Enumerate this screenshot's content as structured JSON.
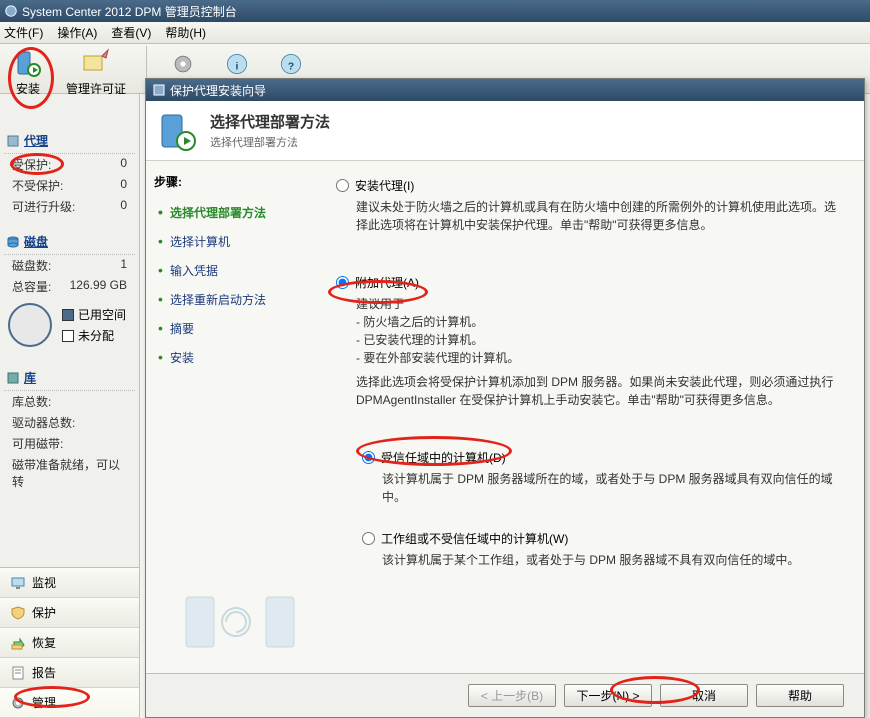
{
  "window_title": "System Center 2012 DPM 管理员控制台",
  "menus": {
    "file": "文件(F)",
    "action": "操作(A)",
    "view": "查看(V)",
    "help": "帮助(H)"
  },
  "tools": {
    "install": "安装",
    "license": "管理许可证",
    "section_label": "代理"
  },
  "sidebar": {
    "agent_header": "代理",
    "protected": "受保护:",
    "protected_val": "0",
    "unprotected": "不受保护:",
    "unprotected_val": "0",
    "upgradeable": "可进行升级:",
    "upgradeable_val": "0",
    "disk_header": "磁盘",
    "disk_count": "磁盘数:",
    "disk_count_val": "1",
    "total_cap": "总容量:",
    "total_cap_val": "126.99 GB",
    "legend_used": "已用空间",
    "legend_unalloc": "未分配",
    "lib_header": "库",
    "lib_total": "库总数:",
    "drive_total": "驱动器总数:",
    "tape_avail": "可用磁带:",
    "tape_ready": "磁带准备就绪，可以转"
  },
  "nav": {
    "monitor": "监视",
    "protect": "保护",
    "recover": "恢复",
    "report": "报告",
    "manage": "管理"
  },
  "wizard": {
    "title": "保护代理安装向导",
    "header": "选择代理部署方法",
    "header_sub": "选择代理部署方法",
    "steps_label": "步骤:",
    "steps": [
      "选择代理部署方法",
      "选择计算机",
      "输入凭据",
      "选择重新启动方法",
      "摘要",
      "安装"
    ],
    "opt_install": "安装代理(I)",
    "opt_install_desc": "建议未处于防火墙之后的计算机或具有在防火墙中创建的所需例外的计算机使用此选项。选择此选项将在计算机中安装保护代理。单击\"帮助\"可获得更多信息。",
    "opt_attach": "附加代理(A)",
    "opt_attach_desc_lines": [
      "建议用于",
      "- 防火墙之后的计算机。",
      "- 已安装代理的计算机。",
      "- 要在外部安装代理的计算机。"
    ],
    "opt_attach_note": "选择此选项会将受保护计算机添加到 DPM 服务器。如果尚未安装此代理，则必须通过执行 DPMAgentInstaller 在受保护计算机上手动安装它。单击\"帮助\"可获得更多信息。",
    "sub_trusted": "受信任域中的计算机(D)",
    "sub_trusted_desc": "该计算机属于 DPM 服务器域所在的域，或者处于与 DPM 服务器域具有双向信任的域中。",
    "sub_workgroup": "工作组或不受信任域中的计算机(W)",
    "sub_workgroup_desc": "该计算机属于某个工作组，或者处于与 DPM 服务器域不具有双向信任的域中。",
    "btn_back": "< 上一步(B)",
    "btn_next": "下一步(N) >",
    "btn_cancel": "取消",
    "btn_help": "帮助"
  }
}
